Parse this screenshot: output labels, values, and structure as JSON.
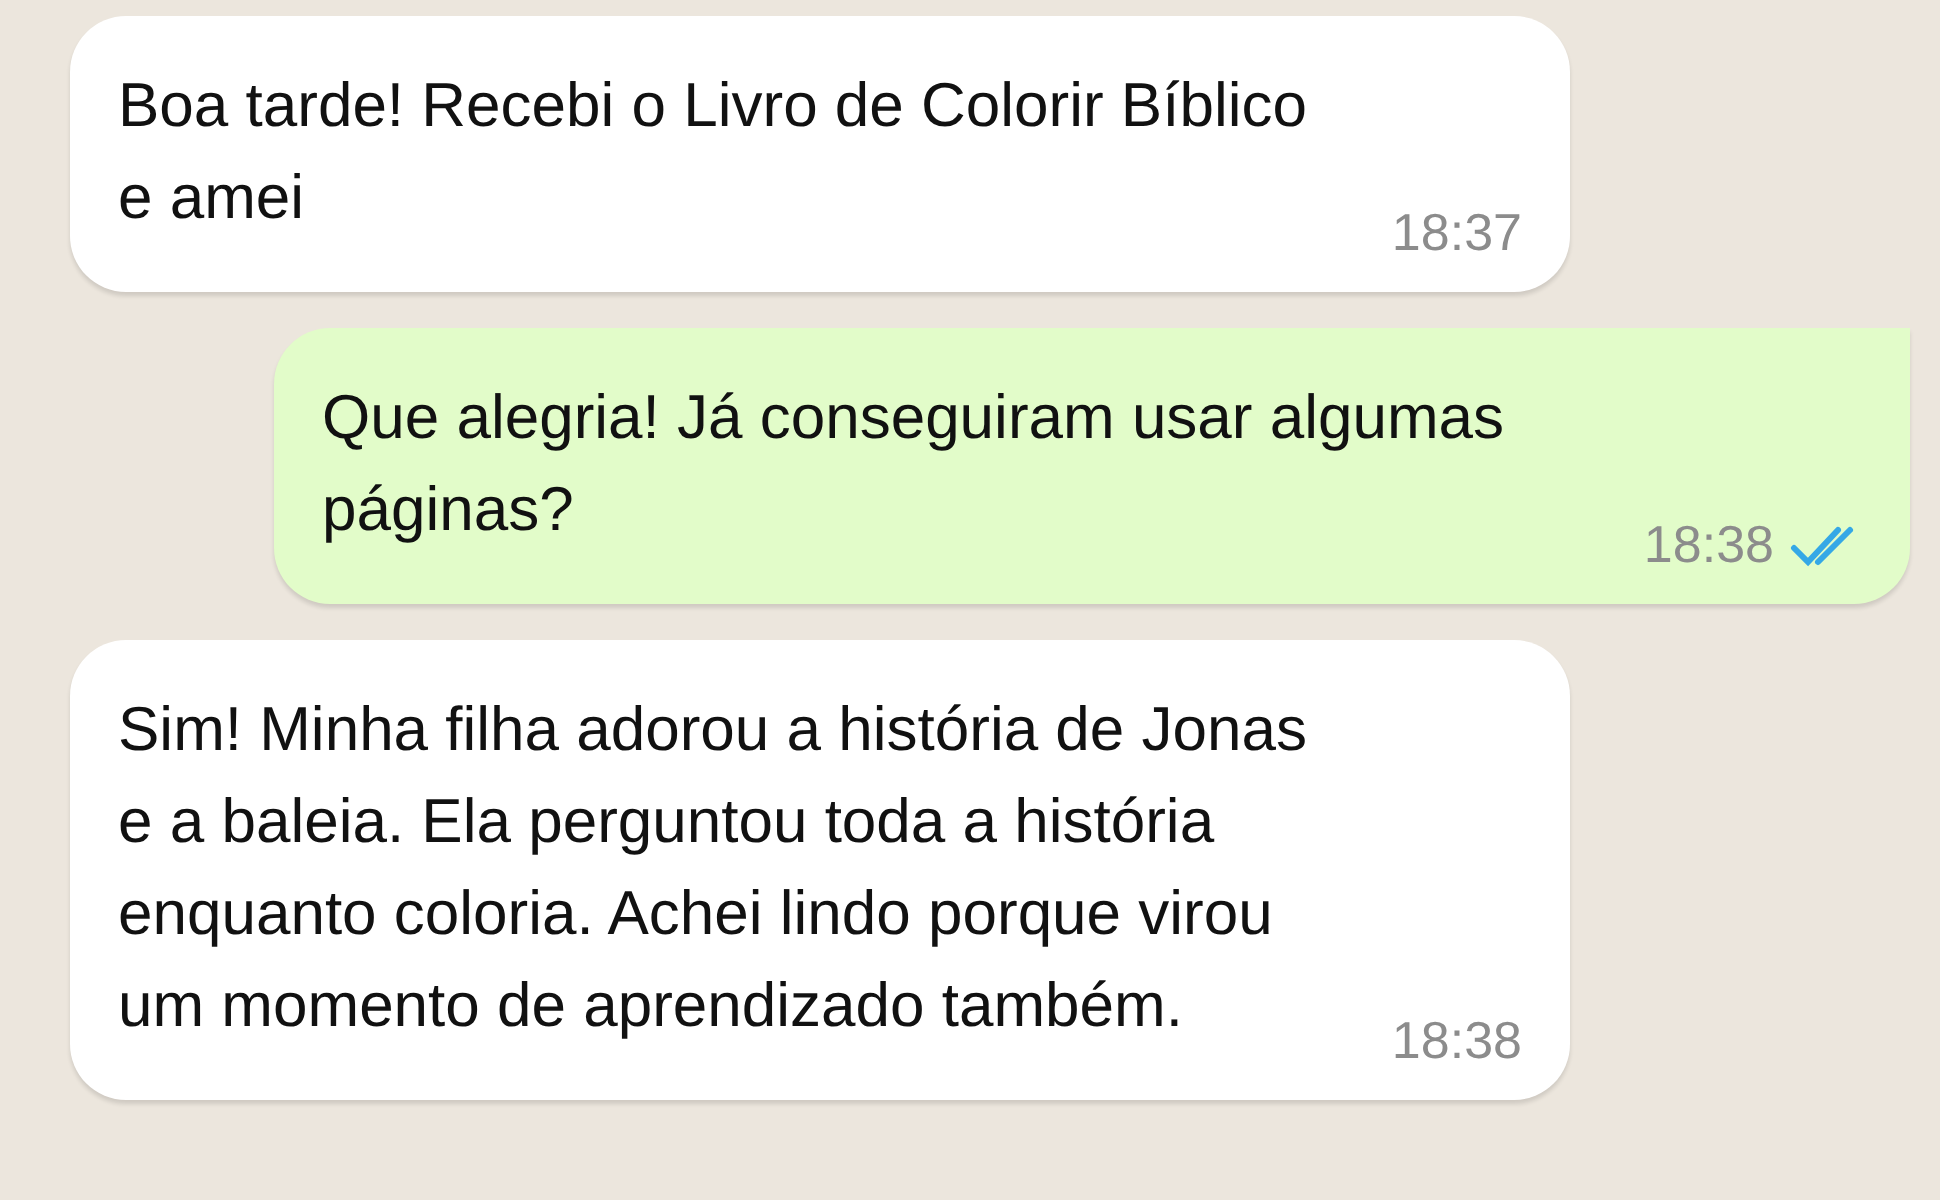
{
  "messages": [
    {
      "kind": "incoming",
      "text": "Boa tarde! Recebi o Livro de Colorir Bíblico e amei",
      "time": "18:37"
    },
    {
      "kind": "outgoing",
      "text": "Que alegria! Já conseguiram usar algumas páginas?",
      "time": "18:38",
      "read": true
    },
    {
      "kind": "incoming",
      "text": "Sim! Minha filha adorou a história de Jonas e a baleia. Ela perguntou toda a história enquanto coloria. Achei lindo porque virou um momento de aprendizado também.",
      "time": "18:38"
    }
  ]
}
